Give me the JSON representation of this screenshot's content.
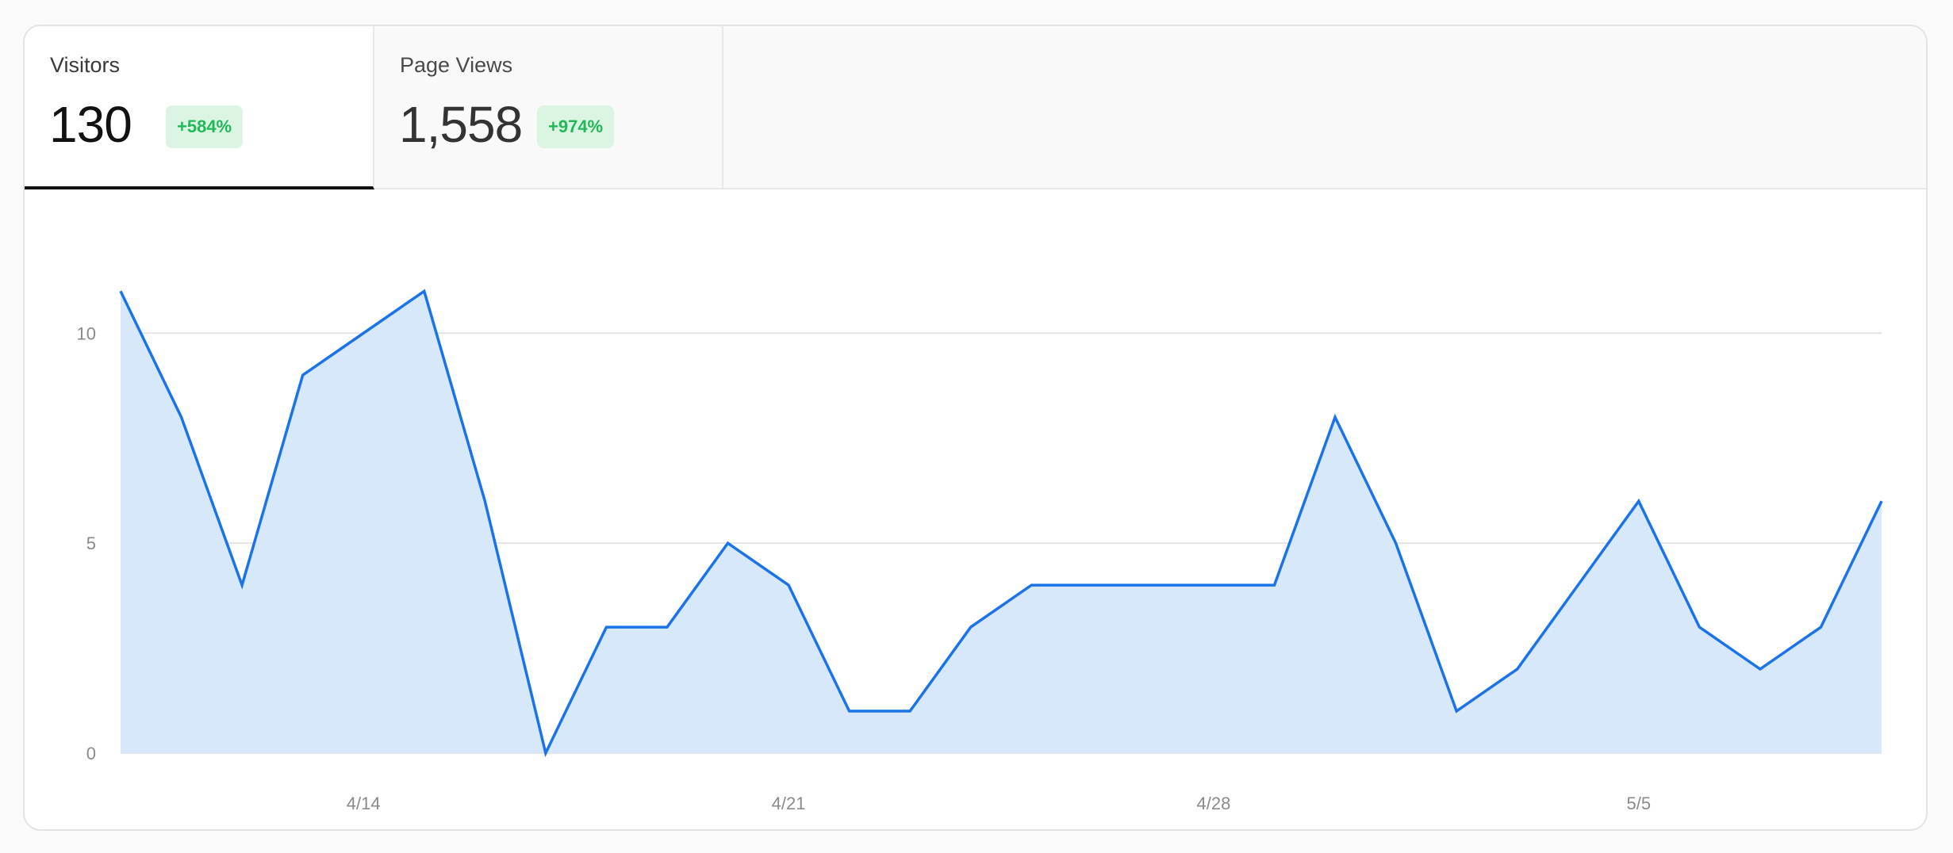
{
  "tabs": [
    {
      "label": "Visitors",
      "value": "130",
      "change": "+584%",
      "active": true
    },
    {
      "label": "Page Views",
      "value": "1,558",
      "change": "+974%",
      "active": false
    }
  ],
  "colors": {
    "line": "#1a73e8",
    "fill": "#d7e8fb",
    "grid": "#e4e4e4",
    "badge_bg": "#dcf5e3",
    "badge_text": "#20b957"
  },
  "chart_data": {
    "type": "area",
    "x": [
      "4/10",
      "4/11",
      "4/12",
      "4/13",
      "4/14",
      "4/15",
      "4/16",
      "4/17",
      "4/18",
      "4/19",
      "4/20",
      "4/21",
      "4/22",
      "4/23",
      "4/24",
      "4/25",
      "4/26",
      "4/27",
      "4/28",
      "4/29",
      "4/30",
      "5/1",
      "5/2",
      "5/3",
      "5/4",
      "5/5",
      "5/6",
      "5/7",
      "5/8",
      "5/9"
    ],
    "series": [
      {
        "name": "Visitors",
        "values": [
          11,
          8,
          4,
          9,
          10,
          11,
          6,
          0,
          3,
          3,
          5,
          4,
          1,
          1,
          3,
          4,
          4,
          4,
          4,
          4,
          8,
          5,
          1,
          2,
          4,
          6,
          3,
          2,
          3,
          6
        ]
      }
    ],
    "yticks": [
      0,
      5,
      10
    ],
    "xticks": [
      "4/14",
      "4/21",
      "4/28",
      "5/5"
    ],
    "ylim": [
      0,
      12
    ],
    "grid": true
  }
}
